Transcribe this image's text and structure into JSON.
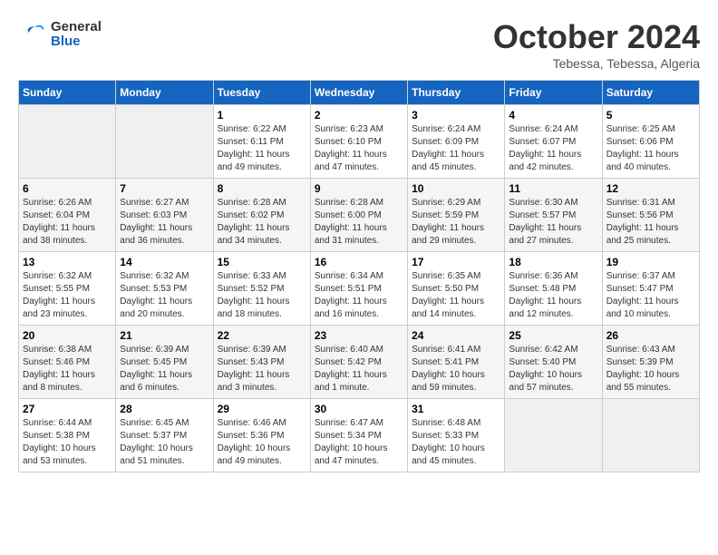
{
  "header": {
    "logo_line1": "General",
    "logo_line2": "Blue",
    "month_title": "October 2024",
    "location": "Tebessa, Tebessa, Algeria"
  },
  "weekdays": [
    "Sunday",
    "Monday",
    "Tuesday",
    "Wednesday",
    "Thursday",
    "Friday",
    "Saturday"
  ],
  "weeks": [
    [
      {
        "day": "",
        "info": ""
      },
      {
        "day": "",
        "info": ""
      },
      {
        "day": "1",
        "info": "Sunrise: 6:22 AM\nSunset: 6:11 PM\nDaylight: 11 hours and 49 minutes."
      },
      {
        "day": "2",
        "info": "Sunrise: 6:23 AM\nSunset: 6:10 PM\nDaylight: 11 hours and 47 minutes."
      },
      {
        "day": "3",
        "info": "Sunrise: 6:24 AM\nSunset: 6:09 PM\nDaylight: 11 hours and 45 minutes."
      },
      {
        "day": "4",
        "info": "Sunrise: 6:24 AM\nSunset: 6:07 PM\nDaylight: 11 hours and 42 minutes."
      },
      {
        "day": "5",
        "info": "Sunrise: 6:25 AM\nSunset: 6:06 PM\nDaylight: 11 hours and 40 minutes."
      }
    ],
    [
      {
        "day": "6",
        "info": "Sunrise: 6:26 AM\nSunset: 6:04 PM\nDaylight: 11 hours and 38 minutes."
      },
      {
        "day": "7",
        "info": "Sunrise: 6:27 AM\nSunset: 6:03 PM\nDaylight: 11 hours and 36 minutes."
      },
      {
        "day": "8",
        "info": "Sunrise: 6:28 AM\nSunset: 6:02 PM\nDaylight: 11 hours and 34 minutes."
      },
      {
        "day": "9",
        "info": "Sunrise: 6:28 AM\nSunset: 6:00 PM\nDaylight: 11 hours and 31 minutes."
      },
      {
        "day": "10",
        "info": "Sunrise: 6:29 AM\nSunset: 5:59 PM\nDaylight: 11 hours and 29 minutes."
      },
      {
        "day": "11",
        "info": "Sunrise: 6:30 AM\nSunset: 5:57 PM\nDaylight: 11 hours and 27 minutes."
      },
      {
        "day": "12",
        "info": "Sunrise: 6:31 AM\nSunset: 5:56 PM\nDaylight: 11 hours and 25 minutes."
      }
    ],
    [
      {
        "day": "13",
        "info": "Sunrise: 6:32 AM\nSunset: 5:55 PM\nDaylight: 11 hours and 23 minutes."
      },
      {
        "day": "14",
        "info": "Sunrise: 6:32 AM\nSunset: 5:53 PM\nDaylight: 11 hours and 20 minutes."
      },
      {
        "day": "15",
        "info": "Sunrise: 6:33 AM\nSunset: 5:52 PM\nDaylight: 11 hours and 18 minutes."
      },
      {
        "day": "16",
        "info": "Sunrise: 6:34 AM\nSunset: 5:51 PM\nDaylight: 11 hours and 16 minutes."
      },
      {
        "day": "17",
        "info": "Sunrise: 6:35 AM\nSunset: 5:50 PM\nDaylight: 11 hours and 14 minutes."
      },
      {
        "day": "18",
        "info": "Sunrise: 6:36 AM\nSunset: 5:48 PM\nDaylight: 11 hours and 12 minutes."
      },
      {
        "day": "19",
        "info": "Sunrise: 6:37 AM\nSunset: 5:47 PM\nDaylight: 11 hours and 10 minutes."
      }
    ],
    [
      {
        "day": "20",
        "info": "Sunrise: 6:38 AM\nSunset: 5:46 PM\nDaylight: 11 hours and 8 minutes."
      },
      {
        "day": "21",
        "info": "Sunrise: 6:39 AM\nSunset: 5:45 PM\nDaylight: 11 hours and 6 minutes."
      },
      {
        "day": "22",
        "info": "Sunrise: 6:39 AM\nSunset: 5:43 PM\nDaylight: 11 hours and 3 minutes."
      },
      {
        "day": "23",
        "info": "Sunrise: 6:40 AM\nSunset: 5:42 PM\nDaylight: 11 hours and 1 minute."
      },
      {
        "day": "24",
        "info": "Sunrise: 6:41 AM\nSunset: 5:41 PM\nDaylight: 10 hours and 59 minutes."
      },
      {
        "day": "25",
        "info": "Sunrise: 6:42 AM\nSunset: 5:40 PM\nDaylight: 10 hours and 57 minutes."
      },
      {
        "day": "26",
        "info": "Sunrise: 6:43 AM\nSunset: 5:39 PM\nDaylight: 10 hours and 55 minutes."
      }
    ],
    [
      {
        "day": "27",
        "info": "Sunrise: 6:44 AM\nSunset: 5:38 PM\nDaylight: 10 hours and 53 minutes."
      },
      {
        "day": "28",
        "info": "Sunrise: 6:45 AM\nSunset: 5:37 PM\nDaylight: 10 hours and 51 minutes."
      },
      {
        "day": "29",
        "info": "Sunrise: 6:46 AM\nSunset: 5:36 PM\nDaylight: 10 hours and 49 minutes."
      },
      {
        "day": "30",
        "info": "Sunrise: 6:47 AM\nSunset: 5:34 PM\nDaylight: 10 hours and 47 minutes."
      },
      {
        "day": "31",
        "info": "Sunrise: 6:48 AM\nSunset: 5:33 PM\nDaylight: 10 hours and 45 minutes."
      },
      {
        "day": "",
        "info": ""
      },
      {
        "day": "",
        "info": ""
      }
    ]
  ]
}
